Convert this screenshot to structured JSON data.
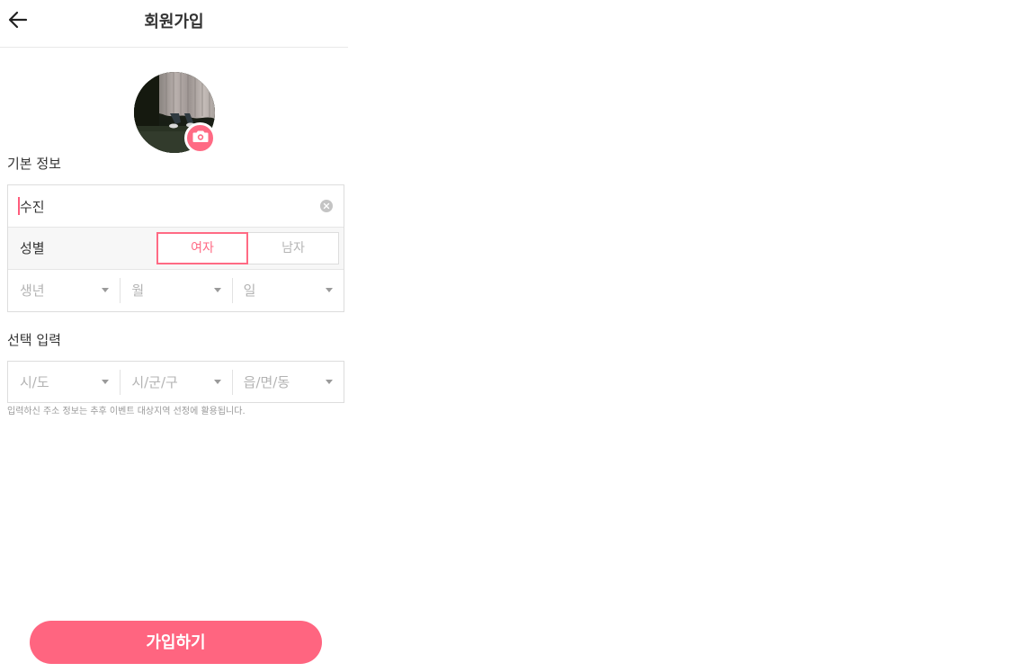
{
  "header": {
    "title": "회원가입",
    "back_icon": "arrow-left-icon"
  },
  "profile": {
    "avatar_icon": "profile-photo",
    "camera_icon": "camera-icon",
    "accent_color": "#ff6a84"
  },
  "basic_info": {
    "section_label": "기본 정보",
    "name_value": "수진",
    "clear_icon": "clear-icon",
    "gender_label": "성별",
    "gender_options": [
      "여자",
      "남자"
    ],
    "gender_selected": "여자",
    "birth_selects": [
      "생년",
      "월",
      "일"
    ]
  },
  "optional": {
    "section_label": "선택 입력",
    "address_selects": [
      "시/도",
      "시/군/구",
      "읍/면/동"
    ],
    "hint": "입력하신 주소 정보는 추후 이벤트 대상지역 선정에 활용됩니다."
  },
  "submit": {
    "label": "가입하기",
    "color": "#ff6580"
  }
}
